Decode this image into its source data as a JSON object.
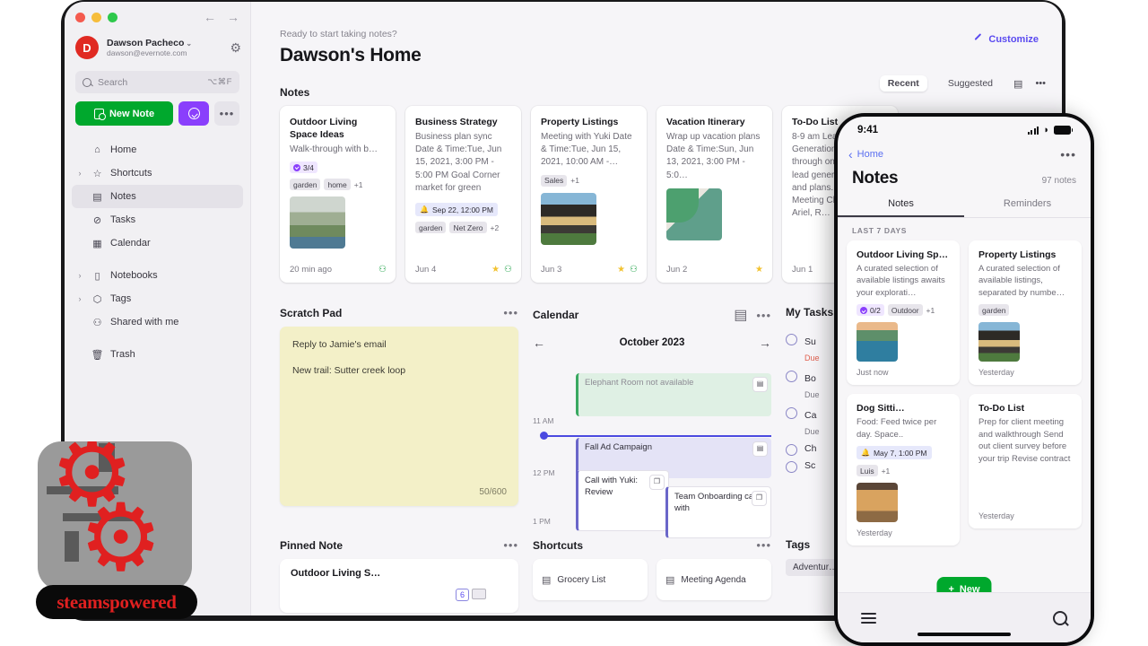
{
  "window": {
    "traffic_lights": [
      "close",
      "minimize",
      "maximize"
    ],
    "back_arrow": "←",
    "forward_arrow": "→"
  },
  "sidebar": {
    "account": {
      "avatar_initial": "D",
      "name": "Dawson Pacheco",
      "chevron": "⌄",
      "email": "dawson@evernote.com",
      "settings_icon": "⚙"
    },
    "search": {
      "placeholder": "Search",
      "shortcut": "⌥⌘F",
      "icon": "search-icon"
    },
    "actions": {
      "new_note_label": "New Note",
      "new_task_icon": "task-check-icon",
      "more_label": "•••"
    },
    "items": [
      {
        "label": "Home",
        "icon": "home-icon",
        "twisty": "",
        "active": false
      },
      {
        "label": "Shortcuts",
        "icon": "star-icon",
        "twisty": "›",
        "active": false
      },
      {
        "label": "Notes",
        "icon": "note-icon",
        "twisty": "",
        "active": true
      },
      {
        "label": "Tasks",
        "icon": "check-circle-icon",
        "twisty": "",
        "active": false
      },
      {
        "label": "Calendar",
        "icon": "calendar-icon",
        "twisty": "",
        "active": false
      },
      {
        "label": "Notebooks",
        "icon": "notebook-icon",
        "twisty": "›",
        "active": false
      },
      {
        "label": "Tags",
        "icon": "tag-icon",
        "twisty": "›",
        "active": false
      },
      {
        "label": "Shared with me",
        "icon": "people-icon",
        "twisty": "",
        "active": false
      },
      {
        "label": "Trash",
        "icon": "trash-icon",
        "twisty": "",
        "active": false
      }
    ]
  },
  "header": {
    "eyebrow": "Ready to start taking notes?",
    "title": "Dawson's Home",
    "customize_label": "Customize",
    "customize_icon": "pencil-icon"
  },
  "tabstrip": {
    "tabs": [
      {
        "label": "Recent",
        "active": true
      },
      {
        "label": "Suggested",
        "active": false
      }
    ],
    "note_icon": "note-add-icon",
    "more": "•••"
  },
  "notes_section": {
    "title": "Notes",
    "cards": [
      {
        "title": "Outdoor Living Space Ideas",
        "snippet": "Walk-through with b…",
        "task_badge": "3/4",
        "tags": [
          "garden",
          "home"
        ],
        "more_tags": "+1",
        "thumb": "patio-photo",
        "date": "20 min ago",
        "starred": false,
        "shared": true
      },
      {
        "title": "Business Strategy",
        "snippet": "Business plan sync Date & Time:Tue, Jun 15, 2021, 3:00 PM - 5:00 PM Goal Corner market for green",
        "reminder": "Sep 22, 12:00 PM",
        "tags": [
          "garden",
          "Net Zero"
        ],
        "more_tags": "+2",
        "date": "Jun 4",
        "starred": true,
        "shared": true
      },
      {
        "title": "Property Listings",
        "snippet": "Meeting with Yuki Date & Time:Tue, Jun 15, 2021, 10:00 AM -…",
        "tags": [
          "Sales"
        ],
        "more_tags": "+1",
        "thumb": "house-photo",
        "date": "Jun 3",
        "starred": true,
        "shared": true
      },
      {
        "title": "Vacation Itinerary",
        "snippet": "Wrap up vacation plans Date & Time:Sun, Jun 13, 2021, 3:00 PM - 5:0…",
        "tags": [],
        "more_tags": "",
        "thumb": "map-photo",
        "date": "Jun 2",
        "starred": true,
        "shared": false
      },
      {
        "title": "To-Do List",
        "snippet": "8-9 am Lead Generation Follow through on your exiting lead generation results and plans. 9-10 Team Meeting Check in with Ariel, R…",
        "tags": [],
        "more_tags": "",
        "date": "Jun 1",
        "starred": false,
        "shared": false
      }
    ]
  },
  "scratch_pad": {
    "title": "Scratch Pad",
    "more": "•••",
    "lines": [
      "Reply to Jamie's email",
      "New trail: Sutter creek loop"
    ],
    "counter": "50/600"
  },
  "calendar": {
    "title": "Calendar",
    "calendar_icon": "calendar-icon",
    "more": "•••",
    "prev": "←",
    "next": "→",
    "month": "October 2023",
    "hours": [
      "11 AM",
      "12 PM",
      "1 PM"
    ],
    "events": [
      {
        "label": "Elephant Room not available",
        "style": "green",
        "icon": "add-event-icon"
      },
      {
        "label": "Fall Ad Campaign",
        "style": "purple",
        "icon": "note-add-icon"
      },
      {
        "label": "Call with Yuki: Review",
        "style": "white",
        "icon": "copy-note-icon"
      },
      {
        "label": "Team Onboarding call with",
        "style": "white",
        "icon": "copy-note-icon"
      }
    ]
  },
  "my_tasks": {
    "title": "My Tasks",
    "items": [
      {
        "label": "Su",
        "due": "Due",
        "due_overdue": true
      },
      {
        "label": "Bo",
        "due": "Due",
        "due_overdue": false
      },
      {
        "label": "Ca",
        "due": "Due",
        "due_overdue": false
      },
      {
        "label": "Ch",
        "due": "",
        "due_overdue": false
      },
      {
        "label": "Sc",
        "due": "",
        "due_overdue": false
      }
    ]
  },
  "bottom": {
    "pinned_note": {
      "title": "Pinned Note",
      "more": "•••",
      "card_title": "Outdoor Living S…"
    },
    "shortcuts": {
      "title": "Shortcuts",
      "more": "•••",
      "items": [
        {
          "label": "Grocery List",
          "icon": "note-icon"
        },
        {
          "label": "Meeting Agenda",
          "icon": "note-icon"
        }
      ]
    },
    "tags": {
      "title": "Tags",
      "items": [
        "Adventur…"
      ]
    }
  },
  "phone": {
    "status": {
      "time": "9:41",
      "signal_icon": "cellular-bars-icon",
      "wifi_icon": "wifi-icon",
      "battery_icon": "battery-icon"
    },
    "nav": {
      "back_label": "Home",
      "back_chevron": "‹",
      "more": "•••"
    },
    "title": "Notes",
    "count": "97 notes",
    "tabs": [
      {
        "label": "Notes",
        "active": true
      },
      {
        "label": "Reminders",
        "active": false
      }
    ],
    "section_label": "LAST 7 DAYS",
    "cards_left": [
      {
        "title": "Outdoor Living Sp…",
        "snippet": "A curated selection of available listings awaits your explorati…",
        "task_badge": "0/2",
        "tags": [
          "Outdoor"
        ],
        "more_tags": "+1",
        "thumb": "coast-photo",
        "date": "Just now"
      },
      {
        "title": "Dog Sitti…",
        "snippet": "Food: Feed twice per day. Space..",
        "reminder": "May 7, 1:00 PM",
        "tags": [
          "Luis"
        ],
        "more_tags": "+1",
        "thumb": "dog-photo",
        "date": "Yesterday"
      }
    ],
    "cards_right": [
      {
        "title": "Property Listings",
        "snippet": "A curated selection of available listings, separated by numbe…",
        "tags": [
          "garden"
        ],
        "more_tags": "",
        "thumb": "house-photo",
        "date": "Yesterday"
      },
      {
        "title": "To-Do List",
        "snippet": "Prep for client meeting and walkthrough Send out client survey before your trip Revise contract",
        "tags": [],
        "more_tags": "",
        "date": "Yesterday"
      }
    ],
    "fab": {
      "label": "New",
      "plus": "+"
    },
    "bottombar": {
      "menu_icon": "hamburger-icon",
      "search_icon": "search-icon"
    }
  },
  "watermark": {
    "text": "steamspowered",
    "icon": "gear-logo-icon"
  },
  "colors": {
    "brand_green": "#00a82d",
    "accent_purple": "#8a3ffc",
    "link_indigo": "#5a4af0",
    "star_yellow": "#f2c230",
    "scratch_yellow": "#f3f0c8"
  }
}
